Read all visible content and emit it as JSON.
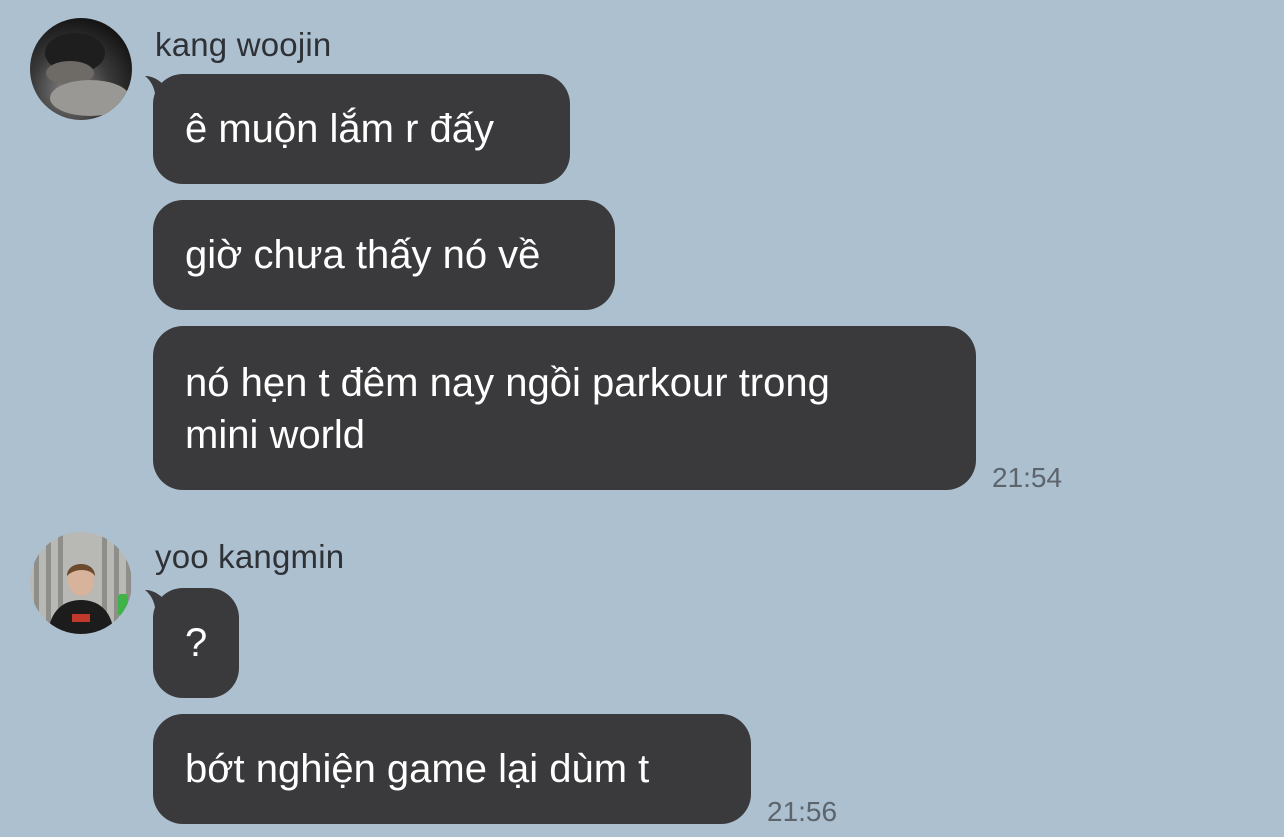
{
  "conversation": {
    "groups": [
      {
        "sender": "kang woojin",
        "avatar": "avatar-dark-sleeping-photo",
        "messages": [
          {
            "text": "ê muộn lắm r đấy"
          },
          {
            "text": "giờ chưa thấy nó về"
          },
          {
            "lines": [
              "nó hẹn t đêm nay ngồi parkour trong",
              "mini world"
            ]
          }
        ],
        "time": "21:54"
      },
      {
        "sender": "yoo kangmin",
        "avatar": "avatar-person-photo",
        "messages": [
          {
            "text": "?"
          },
          {
            "text": "bớt nghiện game lại dùm t"
          }
        ],
        "time": "21:56"
      }
    ]
  },
  "colors": {
    "background": "#adc0d0",
    "bubble": "#3a3a3c",
    "bubble_text": "#ffffff",
    "sender_text": "#2e3136",
    "time_text": "#5c646c"
  }
}
